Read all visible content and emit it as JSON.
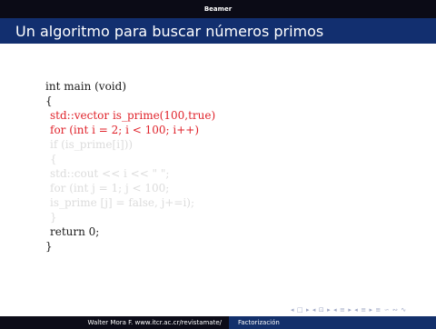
{
  "header": {
    "title": "Beamer"
  },
  "frame": {
    "title": "Un algoritmo para buscar números primos"
  },
  "code": {
    "lines": [
      {
        "text": "int main (void)"
      },
      {
        "text": "{"
      },
      {
        "text": "std::vector is_prime(100,true)"
      },
      {
        "text": "for (int i = 2; i < 100; i++)"
      },
      {
        "text": "if (is_prime[i]))"
      },
      {
        "text": "{"
      },
      {
        "text": "std::cout << i << \" \";"
      },
      {
        "text": "for (int j = 1; j < 100;"
      },
      {
        "text": "is_prime [j] = false, j+=i);"
      },
      {
        "text": "}"
      },
      {
        "text": "return 0;"
      },
      {
        "text": "}"
      }
    ]
  },
  "colors": {
    "normal": "#1a1a1a",
    "highlight": "#e0232b",
    "faded": "#dcdcdc"
  },
  "navigation": {
    "symbols": "◂ □ ▸  ◂ ⊡ ▸  ◂ ≡ ▸  ◂ ≡ ▸   ≡   ∽ ∾ ∿"
  },
  "footer": {
    "author": "Walter Mora F. www.itcr.ac.cr/revistamate/",
    "section": "Factorización"
  }
}
